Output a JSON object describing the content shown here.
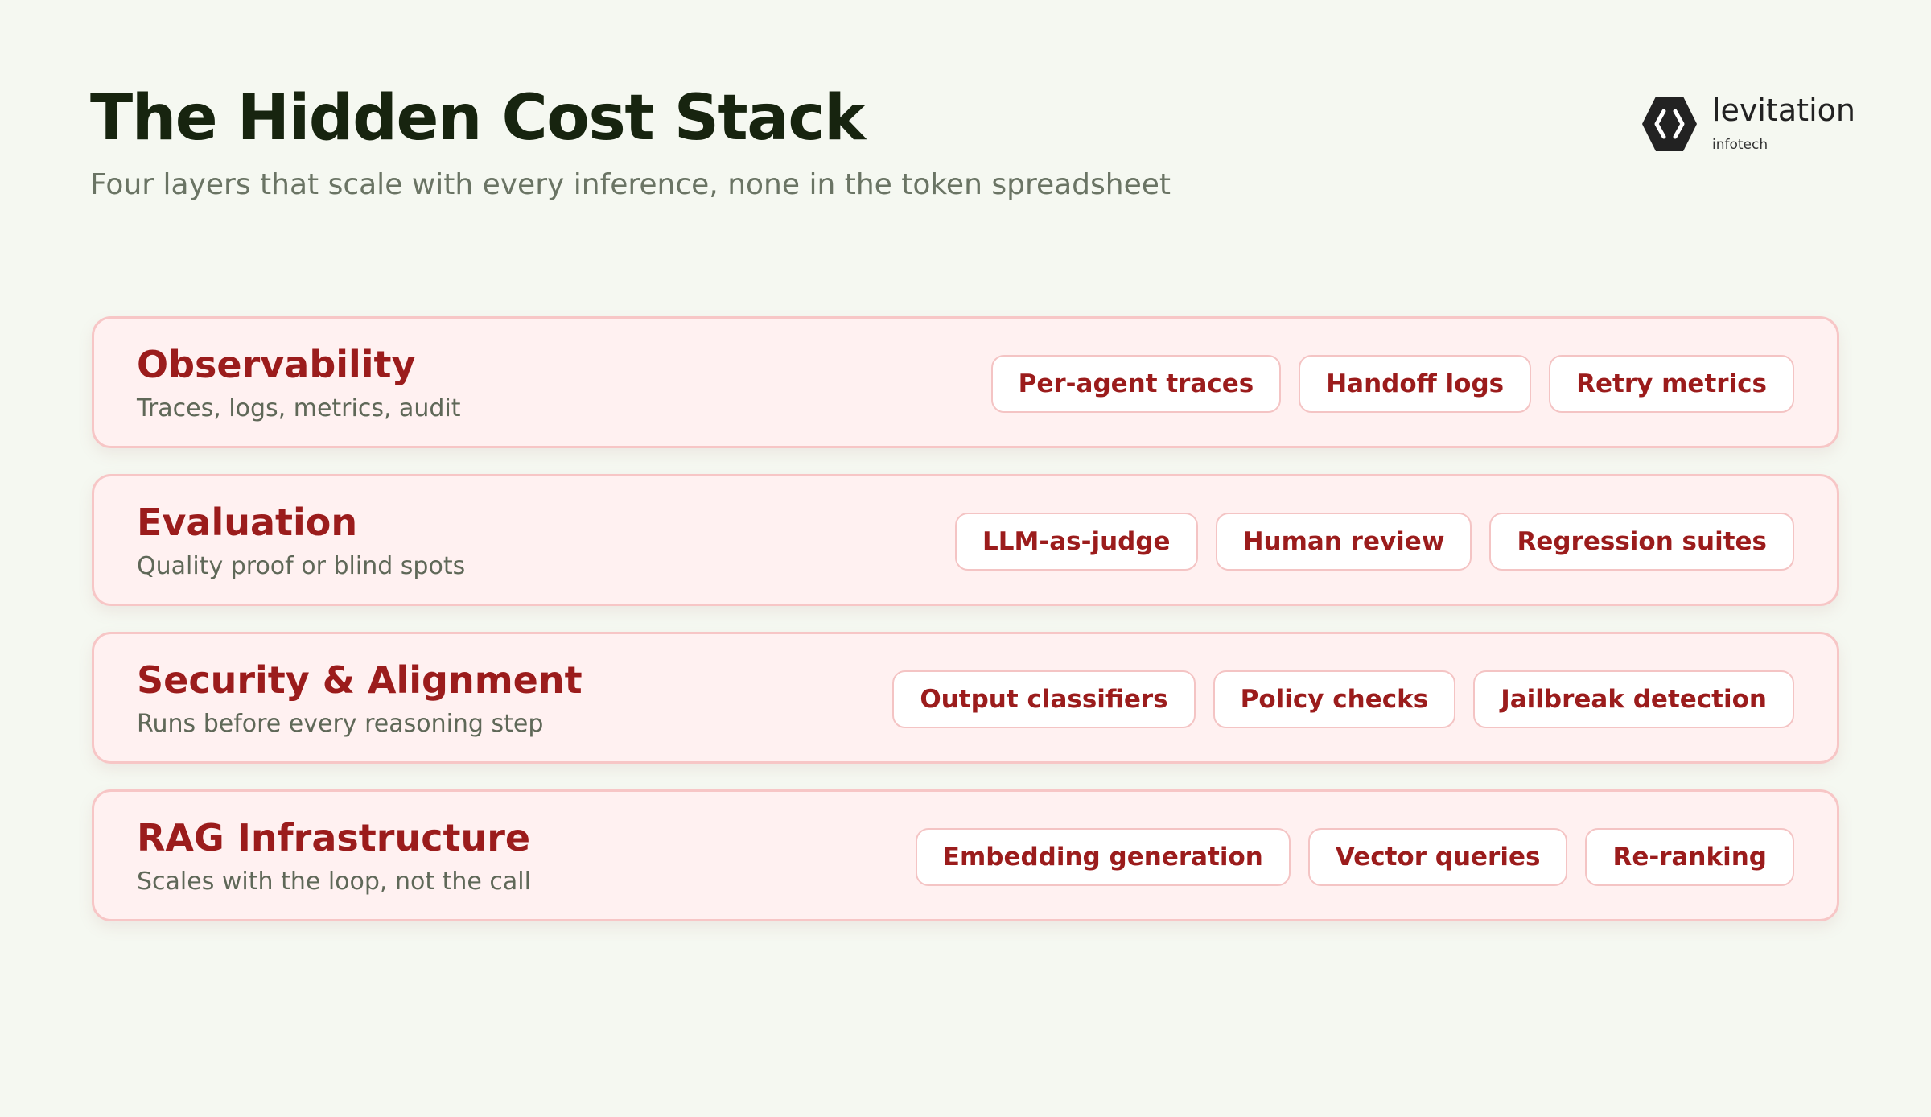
{
  "header": {
    "title": "The Hidden Cost Stack",
    "subtitle": "Four layers that scale with every inference, none in the token spreadsheet"
  },
  "logo": {
    "name": "levitation",
    "sub": "infotech",
    "icon": "hexagon-code-icon"
  },
  "colors": {
    "background": "#f5f8f1",
    "title": "#17240f",
    "accent": "#9b1c1c",
    "card_fill": "#fff1f1",
    "card_border": "#f7c6c6"
  },
  "layers": [
    {
      "name": "Observability",
      "desc": "Traces, logs, metrics, audit",
      "chips": [
        "Per-agent traces",
        "Handoff logs",
        "Retry metrics"
      ]
    },
    {
      "name": "Evaluation",
      "desc": "Quality proof or blind spots",
      "chips": [
        "LLM-as-judge",
        "Human review",
        "Regression suites"
      ]
    },
    {
      "name": "Security & Alignment",
      "desc": "Runs before every reasoning step",
      "chips": [
        "Output classifiers",
        "Policy checks",
        "Jailbreak detection"
      ]
    },
    {
      "name": "RAG Infrastructure",
      "desc": "Scales with the loop, not the call",
      "chips": [
        "Embedding generation",
        "Vector queries",
        "Re-ranking"
      ]
    }
  ]
}
